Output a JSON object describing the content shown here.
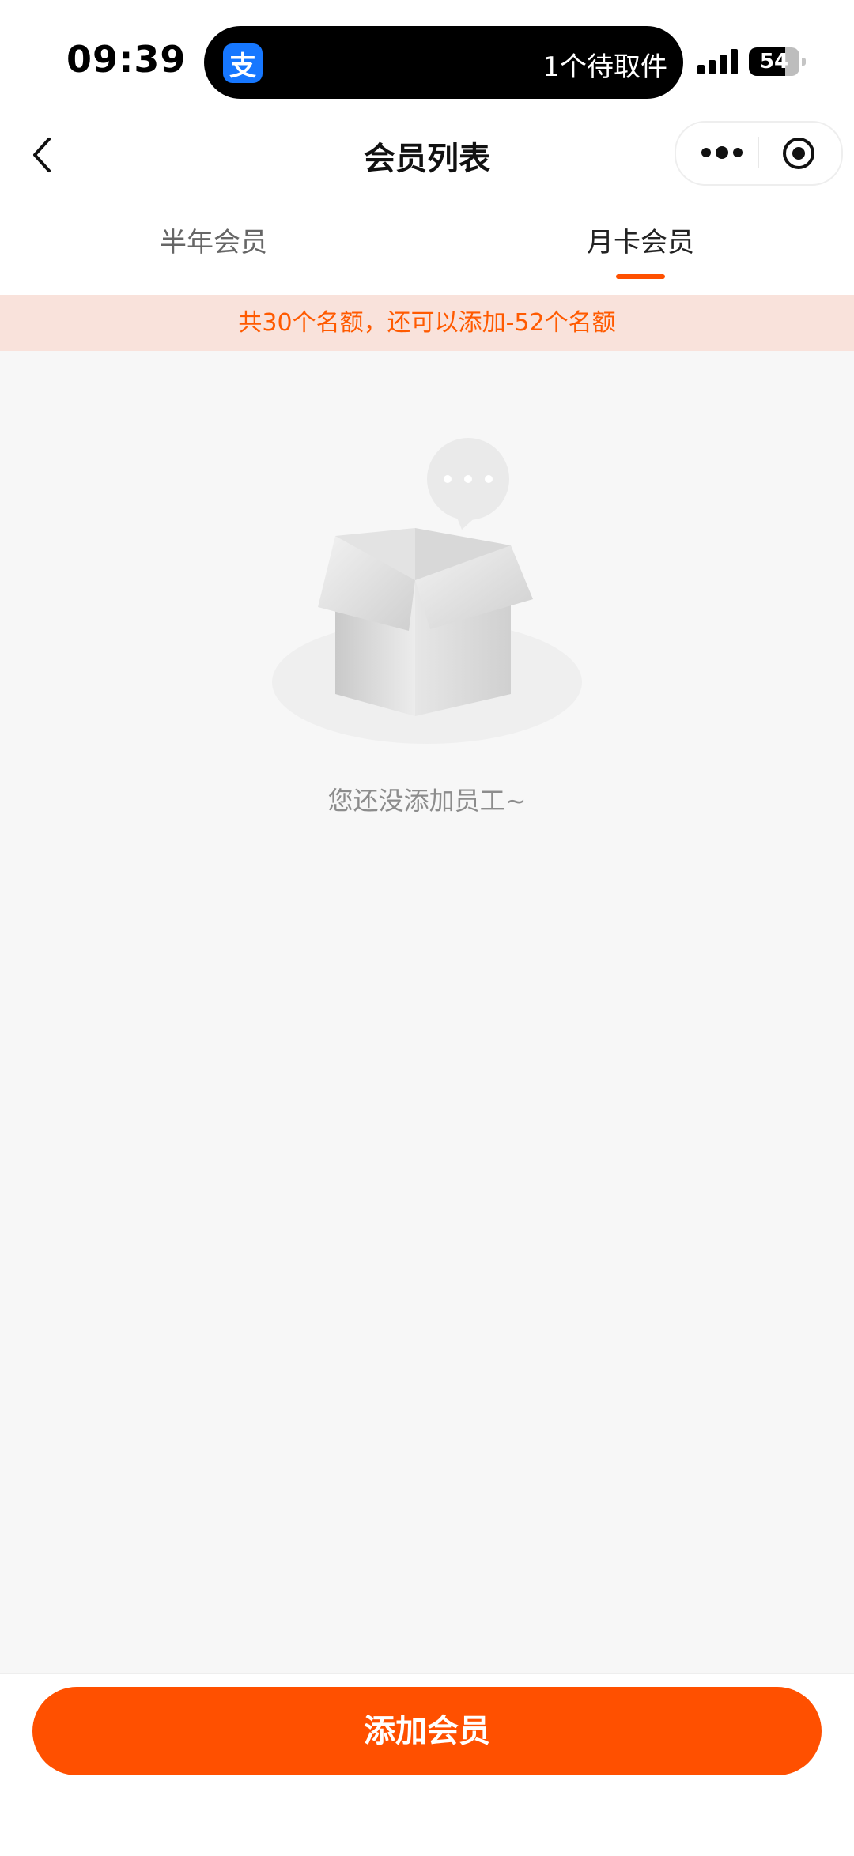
{
  "status_bar": {
    "time": "09:39",
    "island_app_icon": "支",
    "island_text": "1个待取件",
    "battery": "54"
  },
  "navbar": {
    "title": "会员列表"
  },
  "tabs": [
    {
      "label": "半年会员",
      "active": false
    },
    {
      "label": "月卡会员",
      "active": true
    }
  ],
  "notice": {
    "text": "共30个名额，还可以添加-52个名额"
  },
  "empty_state": {
    "message": "您还没添加员工~",
    "illustration": "empty-box-icon"
  },
  "bottom": {
    "add_button_label": "添加会员"
  },
  "colors": {
    "accent": "#ff5000",
    "notice_bg": "#f9e2db",
    "page_bg": "#f7f7f7"
  }
}
